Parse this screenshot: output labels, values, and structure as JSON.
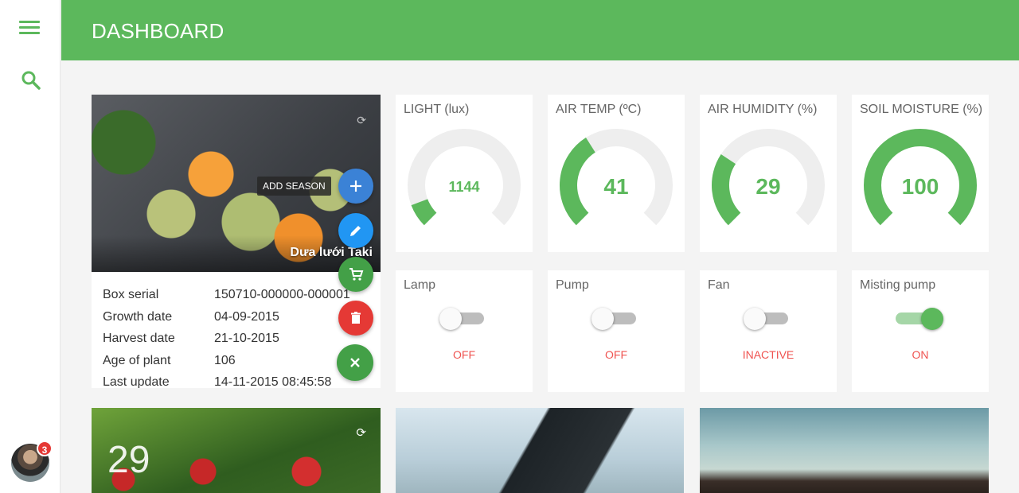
{
  "header": {
    "title": "DASHBOARD"
  },
  "sidebar": {
    "notification_count": "3"
  },
  "plant": {
    "name": "Dưa lưới Taki",
    "tooltip": "ADD SEASON",
    "details": [
      {
        "label": "Box serial",
        "value": "150710-000000-000001"
      },
      {
        "label": "Growth date",
        "value": "04-09-2015"
      },
      {
        "label": "Harvest date",
        "value": "21-10-2015"
      },
      {
        "label": "Age of plant",
        "value": "106"
      },
      {
        "label": "Last update",
        "value": "14-11-2015 08:45:58"
      }
    ],
    "actions": [
      {
        "name": "add-season",
        "color": "#3b82d6"
      },
      {
        "name": "edit",
        "color": "#2196f3"
      },
      {
        "name": "shop",
        "color": "#43a047"
      },
      {
        "name": "delete",
        "color": "#e53935"
      },
      {
        "name": "close",
        "color": "#43a047"
      }
    ]
  },
  "sensors": [
    {
      "title": "LIGHT (lux)",
      "value": "1144",
      "fraction": 0.09
    },
    {
      "title": "AIR TEMP (ºC)",
      "value": "41",
      "fraction": 0.38
    },
    {
      "title": "AIR HUMIDITY (%)",
      "value": "29",
      "fraction": 0.29
    },
    {
      "title": "SOIL MOISTURE (%)",
      "value": "100",
      "fraction": 1.0
    }
  ],
  "devices": [
    {
      "title": "Lamp",
      "on": false,
      "state": "OFF"
    },
    {
      "title": "Pump",
      "on": false,
      "state": "OFF"
    },
    {
      "title": "Fan",
      "on": false,
      "state": "INACTIVE"
    },
    {
      "title": "Misting pump",
      "on": true,
      "state": "ON"
    }
  ],
  "tiles": [
    {
      "number": "29"
    }
  ],
  "colors": {
    "accent": "#5cb85c",
    "gauge_track": "#eeeeee",
    "state_text": "#ef5350"
  }
}
